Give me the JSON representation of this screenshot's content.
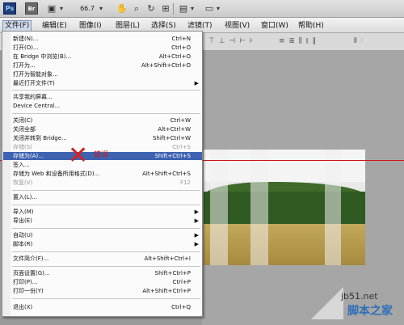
{
  "topbar": {
    "ps": "Ps",
    "br": "Br",
    "zoom": "66.7"
  },
  "menubar": [
    "文件(F)",
    "编辑(E)",
    "图像(I)",
    "图层(L)",
    "选择(S)",
    "滤镜(T)",
    "视图(V)",
    "窗口(W)",
    "帮助(H)"
  ],
  "file_menu": {
    "items": [
      {
        "label": "新建(N)...",
        "shortcut": "Ctrl+N"
      },
      {
        "label": "打开(O)...",
        "shortcut": "Ctrl+O"
      },
      {
        "label": "在 Bridge 中浏览(B)...",
        "shortcut": "Alt+Ctrl+O"
      },
      {
        "label": "打开为...",
        "shortcut": "Alt+Shift+Ctrl+O"
      },
      {
        "label": "打开为智能对象...",
        "shortcut": ""
      },
      {
        "label": "最近打开文件(T)",
        "shortcut": ""
      },
      {
        "label": "共享我的屏幕...",
        "shortcut": ""
      },
      {
        "label": "Device Central...",
        "shortcut": ""
      },
      {
        "label": "关闭(C)",
        "shortcut": "Ctrl+W"
      },
      {
        "label": "关闭全部",
        "shortcut": "Alt+Ctrl+W"
      },
      {
        "label": "关闭并转到 Bridge...",
        "shortcut": "Shift+Ctrl+W"
      },
      {
        "label": "存储(S)",
        "shortcut": "Ctrl+S"
      },
      {
        "label": "存储为(A)...",
        "shortcut": "Shift+Ctrl+S"
      },
      {
        "label": "签入...",
        "shortcut": ""
      },
      {
        "label": "存储为 Web 和设备所用格式(D)...",
        "shortcut": "Alt+Shift+Ctrl+S"
      },
      {
        "label": "恢复(V)",
        "shortcut": "F12"
      },
      {
        "label": "置入(L)...",
        "shortcut": ""
      },
      {
        "label": "导入(M)",
        "shortcut": ""
      },
      {
        "label": "导出(E)",
        "shortcut": ""
      },
      {
        "label": "自动(U)",
        "shortcut": ""
      },
      {
        "label": "脚本(R)",
        "shortcut": ""
      },
      {
        "label": "文件简介(F)...",
        "shortcut": "Alt+Shift+Ctrl+I"
      },
      {
        "label": "页面设置(G)...",
        "shortcut": "Shift+Ctrl+P"
      },
      {
        "label": "打印(P)...",
        "shortcut": "Ctrl+P"
      },
      {
        "label": "打印一份(Y)",
        "shortcut": "Alt+Shift+Ctrl+P"
      },
      {
        "label": "退出(X)",
        "shortcut": "Ctrl+Q"
      }
    ]
  },
  "annotation": {
    "error_label": "错误"
  },
  "watermark": {
    "url": "jb51.net",
    "logo": "脚本之家"
  }
}
